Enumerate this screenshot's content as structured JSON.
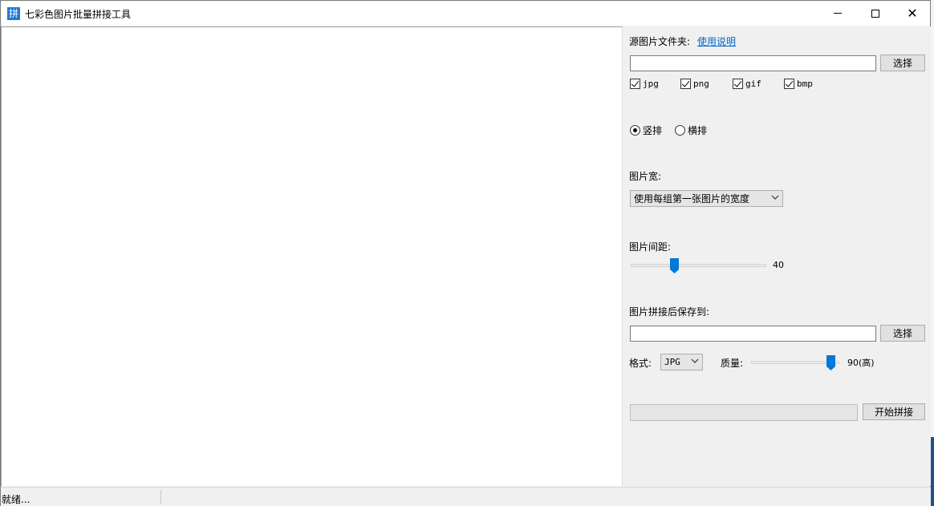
{
  "window": {
    "title": "七彩色图片批量拼接工具",
    "icon_glyph": "拼",
    "controls": [
      "minimize-icon",
      "maximize-icon",
      "close-icon"
    ]
  },
  "source": {
    "label": "源图片文件夹:",
    "help_link": "使用说明",
    "path_value": "",
    "browse_label": "选择"
  },
  "formats": [
    {
      "label": "jpg",
      "checked": true
    },
    {
      "label": "png",
      "checked": true
    },
    {
      "label": "gif",
      "checked": true
    },
    {
      "label": "bmp",
      "checked": true
    }
  ],
  "layout": {
    "vertical_label": "竖排",
    "horizontal_label": "横排",
    "selected": "vertical"
  },
  "width": {
    "label": "图片宽:",
    "selected": "使用每组第一张图片的宽度"
  },
  "spacing": {
    "label": "图片间距:",
    "value": "40",
    "level": 0.32
  },
  "output": {
    "label": "图片拼接后保存到:",
    "path_value": "",
    "browse_label": "选择",
    "format_label": "格式:",
    "format_selected": "JPG",
    "quality_label": "质量:",
    "quality_value": "90(高)",
    "quality_level": 0.9
  },
  "action": {
    "progress": 0,
    "start_label": "开始拼接"
  },
  "status": {
    "text": "就绪..."
  },
  "colors": {
    "accent": "#0078d7",
    "link": "#0066cc",
    "app_icon": "#1e7ad6"
  }
}
